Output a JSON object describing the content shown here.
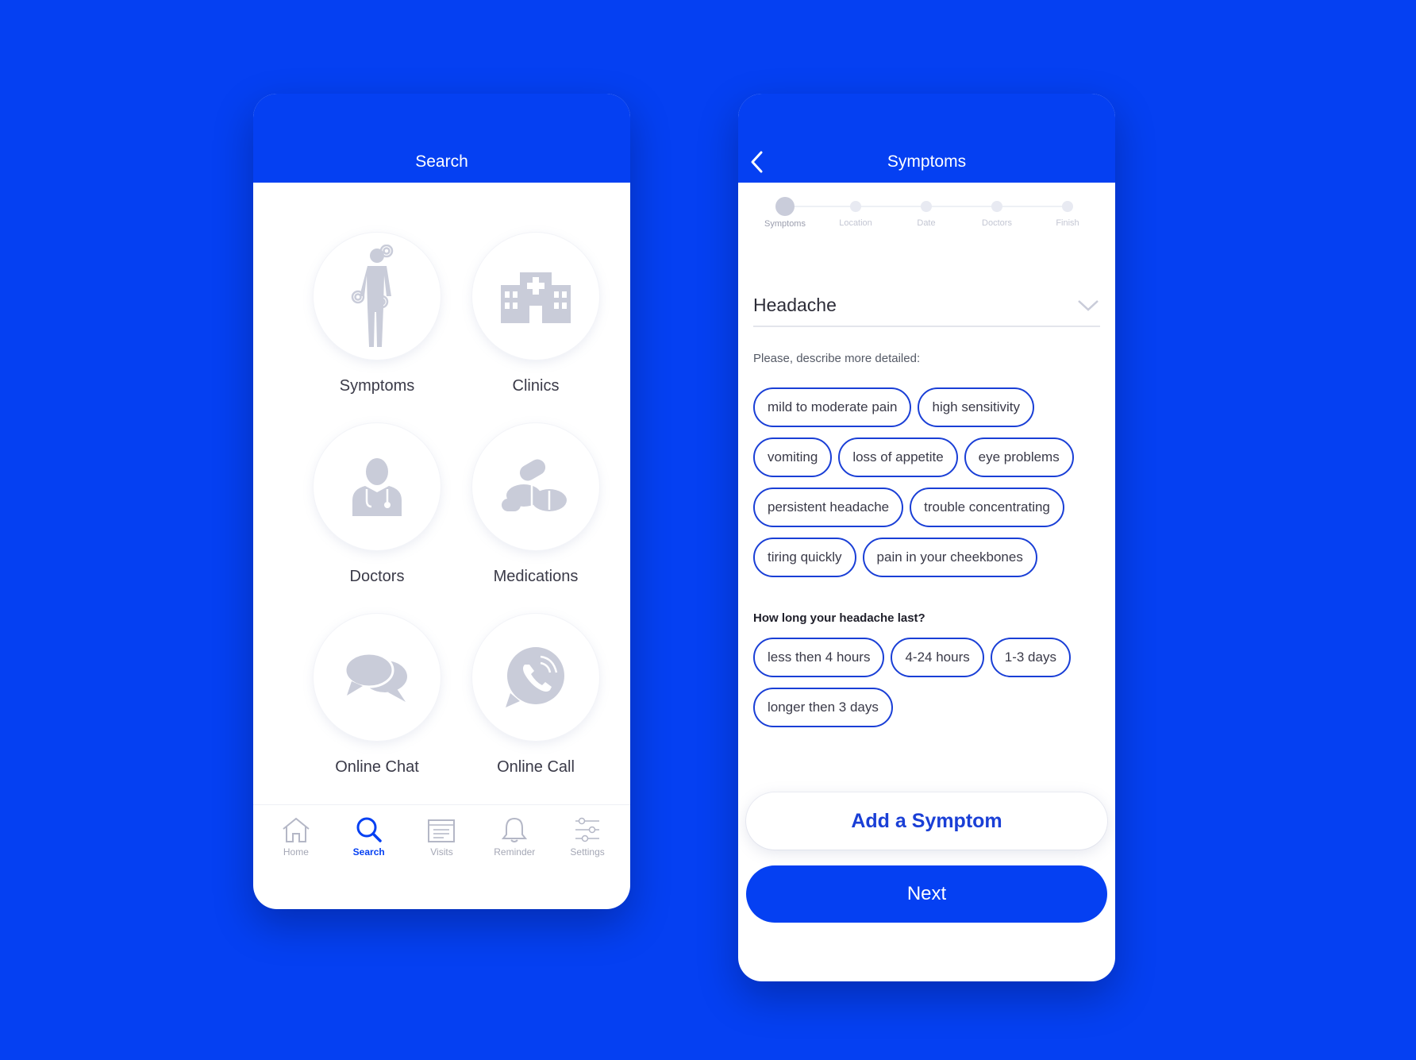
{
  "colors": {
    "brand": "#0540f2",
    "chip_border": "#1a3fd6",
    "muted_icon": "#c9ccd9"
  },
  "search_screen": {
    "title": "Search",
    "tiles": [
      {
        "label": "Symptoms",
        "icon": "body-icon"
      },
      {
        "label": "Clinics",
        "icon": "hospital-icon"
      },
      {
        "label": "Doctors",
        "icon": "doctor-icon"
      },
      {
        "label": "Medications",
        "icon": "pills-icon"
      },
      {
        "label": "Online Chat",
        "icon": "chat-icon"
      },
      {
        "label": "Online Call",
        "icon": "phone-icon"
      }
    ],
    "nav": [
      {
        "label": "Home",
        "icon": "home-icon"
      },
      {
        "label": "Search",
        "icon": "search-icon"
      },
      {
        "label": "Visits",
        "icon": "calendar-icon"
      },
      {
        "label": "Reminder",
        "icon": "bell-icon"
      },
      {
        "label": "Settings",
        "icon": "sliders-icon"
      }
    ],
    "active_nav": "Search"
  },
  "symptoms_screen": {
    "title": "Symptoms",
    "steps": [
      "Symptoms",
      "Location",
      "Date",
      "Doctors",
      "Finish"
    ],
    "current_step": "Symptoms",
    "dropdown_value": "Headache",
    "describe_prompt": "Please, describe more detailed:",
    "detail_chips": [
      "mild to moderate pain",
      "high sensitivity",
      "vomiting",
      "loss of appetite",
      "eye problems",
      "persistent headache",
      "trouble concentrating",
      "tiring quickly",
      "pain in your cheekbones"
    ],
    "duration_prompt": "How long your headache last?",
    "duration_chips": [
      "less then 4 hours",
      "4-24 hours",
      "1-3 days",
      "longer then 3 days"
    ],
    "add_button": "Add a Symptom",
    "next_button": "Next"
  }
}
